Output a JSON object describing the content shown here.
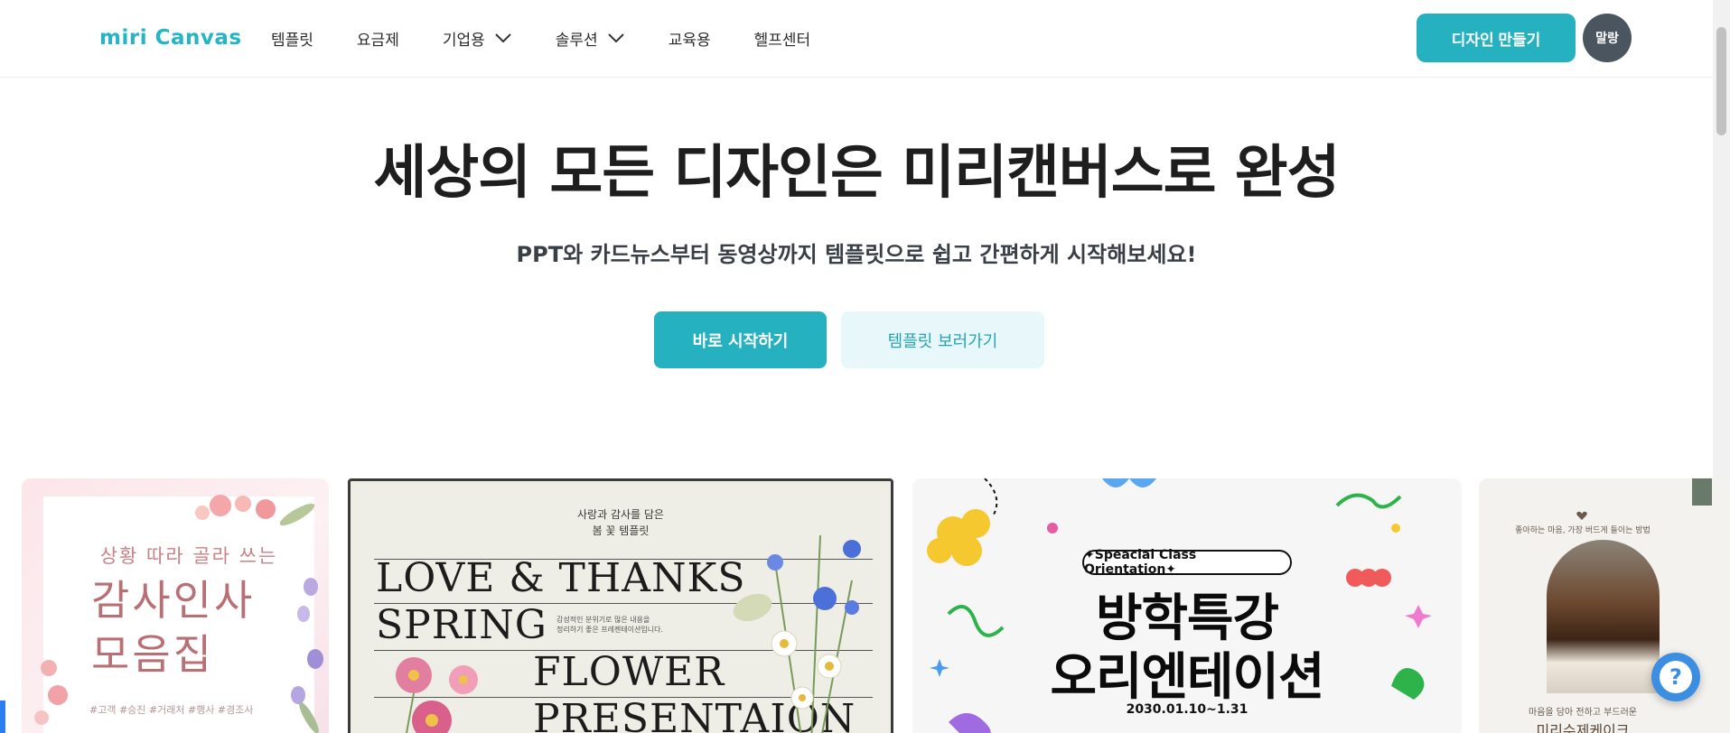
{
  "brand": {
    "logo_text": "miri Canvas",
    "accent": "#25b1bf"
  },
  "nav": {
    "items": [
      {
        "label": "템플릿",
        "dropdown": false
      },
      {
        "label": "요금제",
        "dropdown": false
      },
      {
        "label": "기업용",
        "dropdown": true
      },
      {
        "label": "솔루션",
        "dropdown": true
      },
      {
        "label": "교육용",
        "dropdown": false
      },
      {
        "label": "헬프센터",
        "dropdown": false
      }
    ],
    "make_design_label": "디자인 만들기",
    "avatar_label": "말랑"
  },
  "hero": {
    "title": "세상의 모든 디자인은 미리캔버스로 완성",
    "subtitle": "PPT와 카드뉴스부터 동영상까지 템플릿으로 쉽고 간편하게 시작해보세요!",
    "start_label": "바로 시작하기",
    "templates_label": "템플릿 보러가기"
  },
  "cards": {
    "c1": {
      "top": "상황 따라 골라 쓰는",
      "line1": "감사인사",
      "line2": "모음집",
      "tags": "#고객 #승진 #거래처 #행사 #경조사"
    },
    "c2": {
      "small1": "사랑과 감사를 담은",
      "small2": "봄 꽃 템플릿",
      "line1": "LOVE & THANKS",
      "line2": "SPRING",
      "line3": "FLOWER",
      "line4": "PRESENTAION",
      "mini1": "감성적인 분위기로 많은 내용을",
      "mini2": "정리하기 좋은 프레젠테이션입니다."
    },
    "c3": {
      "pill": "✦Speacial Class Orientation✦",
      "line1": "방학특강",
      "line2": "오리엔테이션",
      "date": "2030.01.10~1.31"
    },
    "c4": {
      "small": "좋아하는 마음, 가장 버드게 들이는 방법",
      "bottom": "마음을 담아 전하고 부드러운",
      "title": "미리수제케이크"
    }
  }
}
